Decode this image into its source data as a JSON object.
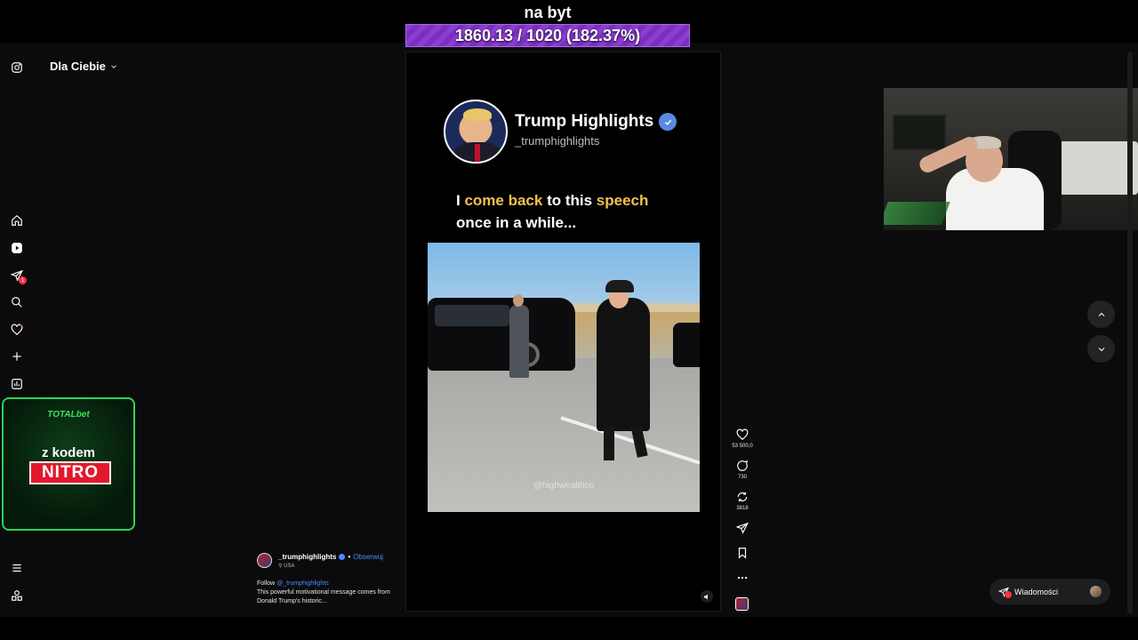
{
  "stream_overlay": {
    "title": "na byt",
    "progress_text": "1860.13 / 1020 (182.37%)",
    "progress_fraction": 1.0
  },
  "header": {
    "feed_selector": "Dla Ciebie",
    "logo_icon": "instagram-icon"
  },
  "sidebar": {
    "items": [
      {
        "icon": "home-icon"
      },
      {
        "icon": "reels-icon"
      },
      {
        "icon": "messages-icon",
        "badge": "1"
      },
      {
        "icon": "search-icon"
      },
      {
        "icon": "notifications-icon"
      },
      {
        "icon": "create-icon"
      },
      {
        "icon": "dashboard-icon"
      }
    ],
    "bottom_items": [
      {
        "icon": "menu-icon"
      },
      {
        "icon": "threads-icon"
      }
    ]
  },
  "ad": {
    "brand_a": "TOTAL",
    "brand_b": "bet",
    "line1": "z kodem",
    "line2": "NITRO"
  },
  "video": {
    "channel_name": "Trump Highlights",
    "channel_handle": "_trumphighlights",
    "caption_parts": [
      "I ",
      "come back",
      " to this ",
      "speech",
      "once in a while..."
    ],
    "watermark": "@highwealthco"
  },
  "actions": {
    "likes": "53 500,0",
    "comments": "730",
    "reposts": "3818"
  },
  "post": {
    "username": "_trumphighlights",
    "separator": "•",
    "follow_label": "Obserwuj",
    "location": "USA",
    "desc_prefix": "Follow ",
    "desc_mention": "@_trumphighlights",
    "desc_text": "This powerful motivational message comes from Donald Trump's historic..."
  },
  "messages": {
    "label": "Wiadomości",
    "badge": "1"
  },
  "colors": {
    "accent_highlight": "#f2c14e",
    "link_blue": "#4a8cff",
    "ad_green": "#33d15a",
    "overlay_purple": "#8c3dd1"
  }
}
